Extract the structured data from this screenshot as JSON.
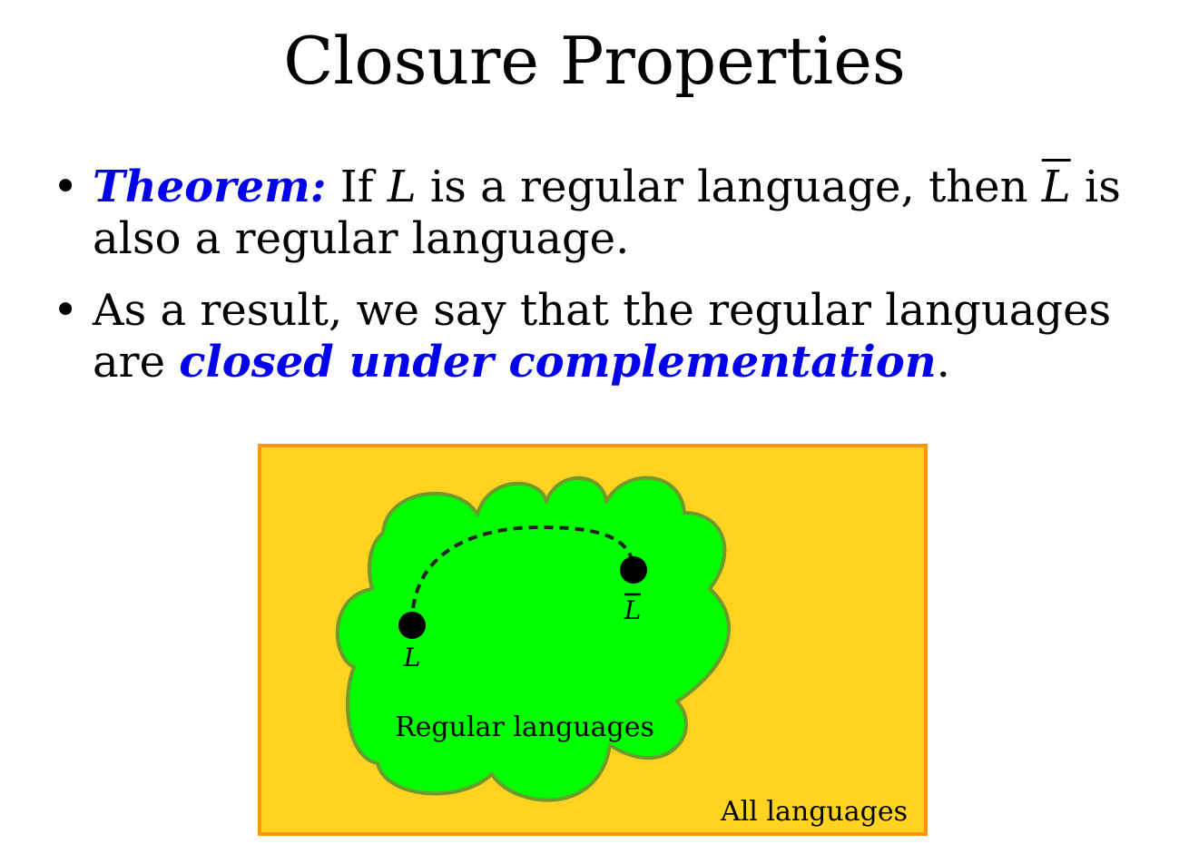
{
  "slide": {
    "title": "Closure Properties"
  },
  "bullets": [
    {
      "theorem_label": "Theorem:",
      "text_1": " If ",
      "var_1": "L",
      "text_2": " is a regular language, then ",
      "var_2": "L",
      "text_3": " is also a regular language."
    },
    {
      "text_1": "As a result, we say that the regular languages are ",
      "emphasis": "closed under complementation",
      "text_2": "."
    }
  ],
  "diagram": {
    "outer_label": "All languages",
    "cloud_label": "Regular languages",
    "node_l_label": "L",
    "node_lbar_label": "L",
    "colors": {
      "outer_fill": "#ffd320",
      "outer_stroke": "#ff950e",
      "cloud_fill": "#00ff00",
      "cloud_stroke": "#6c9a2c",
      "node": "#000000",
      "accent_text": "#0000ee"
    }
  }
}
